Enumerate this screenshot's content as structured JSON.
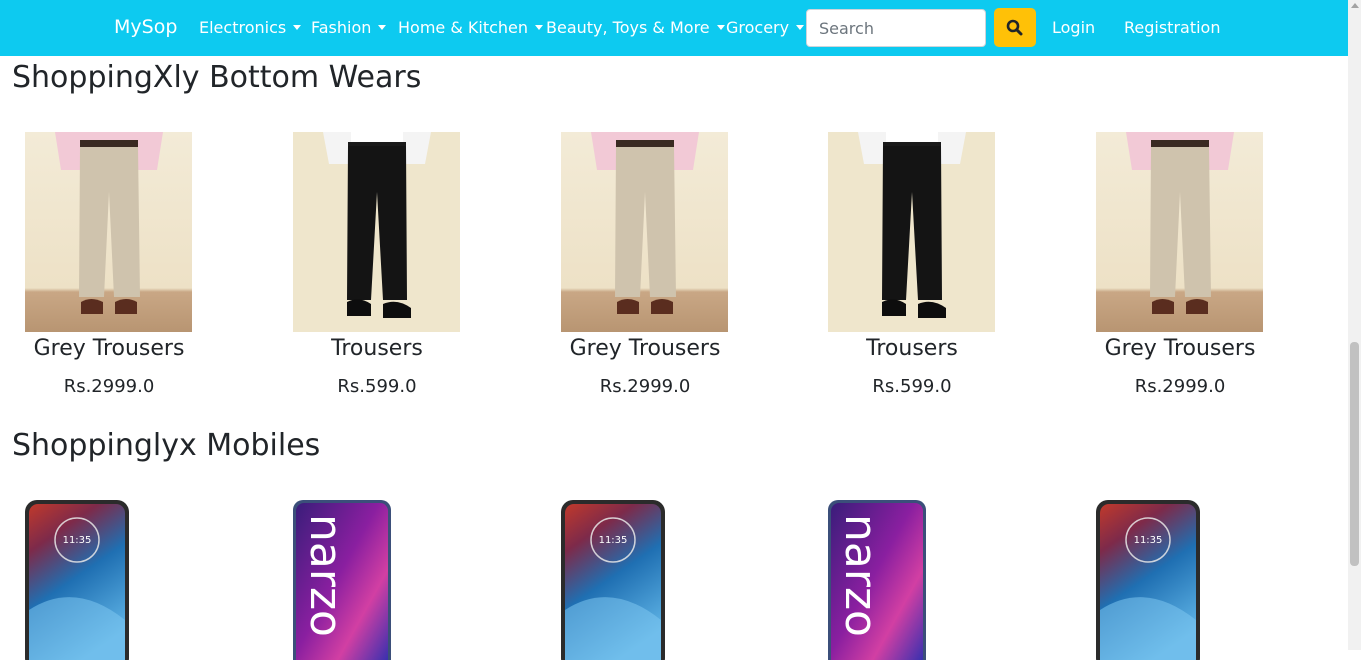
{
  "navbar": {
    "brand": "MySop",
    "menus": [
      {
        "label": "Electronics"
      },
      {
        "label": "Fashion"
      },
      {
        "label": "Home & Kitchen"
      },
      {
        "label": "Beauty, Toys & More"
      },
      {
        "label": "Grocery"
      }
    ],
    "search_placeholder": "Search",
    "search_value": "",
    "search_icon": "search-icon",
    "login": "Login",
    "registration": "Registration",
    "colors": {
      "navbar": "#0dcaf0",
      "search_button": "#ffc107"
    }
  },
  "sections": [
    {
      "title": "ShoppingXly Bottom Wears",
      "products": [
        {
          "name": "Grey Trousers",
          "price": "Rs.2999.0",
          "color": "grey"
        },
        {
          "name": "Trousers",
          "price": "Rs.599.0",
          "color": "black"
        },
        {
          "name": "Grey Trousers",
          "price": "Rs.2999.0",
          "color": "grey"
        },
        {
          "name": "Trousers",
          "price": "Rs.599.0",
          "color": "black"
        },
        {
          "name": "Grey Trousers",
          "price": "Rs.2999.0",
          "color": "grey"
        }
      ]
    },
    {
      "title": "Shoppinglyx Mobiles",
      "products": [
        {
          "type": "moto",
          "clock": "11:35"
        },
        {
          "type": "narzo",
          "screen_text": "narzo"
        },
        {
          "type": "moto",
          "clock": "11:35"
        },
        {
          "type": "narzo",
          "screen_text": "narzo"
        },
        {
          "type": "moto",
          "clock": "11:35"
        }
      ]
    }
  ]
}
